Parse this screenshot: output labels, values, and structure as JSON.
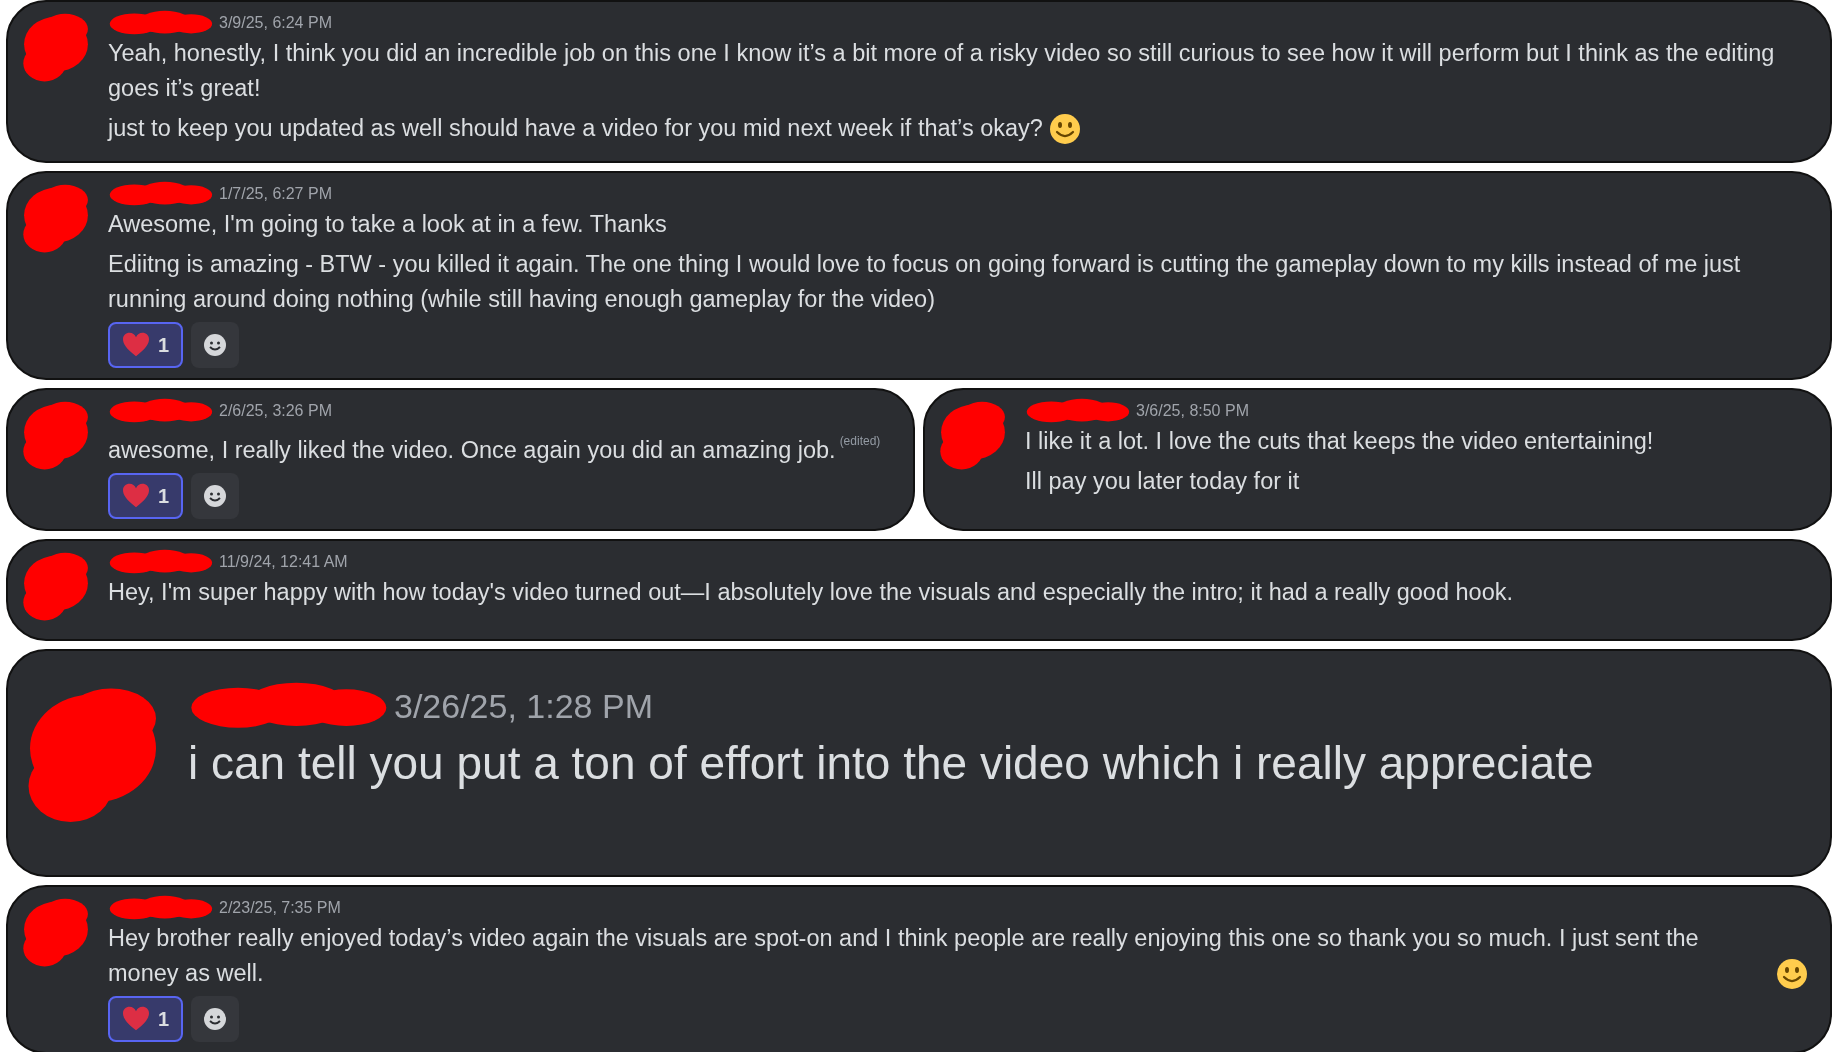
{
  "rows": [
    {
      "messages": [
        {
          "kind": "normal",
          "timestamp": "3/9/25, 6:24 PM",
          "paragraphs": [
            {
              "text": "Yeah, honestly, I think you did an incredible job on this one I know it’s a bit more of a risky video so still curious to see how it will perform but I think as the editing goes it’s great!",
              "emoji": false
            },
            {
              "text": "just to keep you updated as well should have a video for you mid next week if that’s okay?",
              "emoji": true
            }
          ]
        }
      ]
    },
    {
      "messages": [
        {
          "kind": "normal",
          "timestamp": "1/7/25, 6:27 PM",
          "paragraphs": [
            {
              "text": "Awesome, I'm going to take a look at in a few. Thanks",
              "emoji": false
            },
            {
              "text": "Ediitng is amazing - BTW - you killed it again. The one thing I would love to focus on going forward is cutting the gameplay down to my kills instead of me just running around doing nothing  (while still having enough gameplay for the video)",
              "emoji": false
            }
          ],
          "reactions": [
            {
              "count": "1",
              "selected": true
            }
          ]
        }
      ]
    },
    {
      "messages": [
        {
          "kind": "normal",
          "timestamp": "2/6/25, 3:26 PM",
          "paragraphs": [
            {
              "text": "awesome, I really liked the video. Once again you did an amazing job.",
              "emoji": false,
              "edited": "(edited)"
            }
          ],
          "reactions": [
            {
              "count": "1",
              "selected": true
            }
          ]
        },
        {
          "kind": "normal",
          "timestamp": "3/6/25, 8:50 PM",
          "paragraphs": [
            {
              "text": "I like it a lot. I love the cuts that keeps the video entertaining!",
              "emoji": false
            },
            {
              "text": "Ill pay you later today for it",
              "emoji": false
            }
          ]
        }
      ]
    },
    {
      "messages": [
        {
          "kind": "normal",
          "timestamp": "11/9/24, 12:41 AM",
          "paragraphs": [
            {
              "text": "Hey, I'm super happy with how today's video turned out—I absolutely love the visuals and especially the intro; it had a really good hook.",
              "emoji": false
            }
          ]
        }
      ]
    },
    {
      "messages": [
        {
          "kind": "large",
          "timestamp": "3/26/25, 1:28 PM",
          "paragraphs": [
            {
              "text": "i can tell you put a ton of effort into the video which i really appreciate",
              "emoji": false
            }
          ]
        }
      ]
    },
    {
      "messages": [
        {
          "kind": "normal",
          "timestamp": "2/23/25, 7:35 PM",
          "paragraphs": [
            {
              "text": "Hey brother really enjoyed today’s video again the visuals are spot-on and I think people are really enjoying this one so thank you so much. I just sent the money as well.",
              "emoji": true
            }
          ],
          "reactions": [
            {
              "count": "1",
              "selected": true
            }
          ]
        }
      ]
    }
  ]
}
